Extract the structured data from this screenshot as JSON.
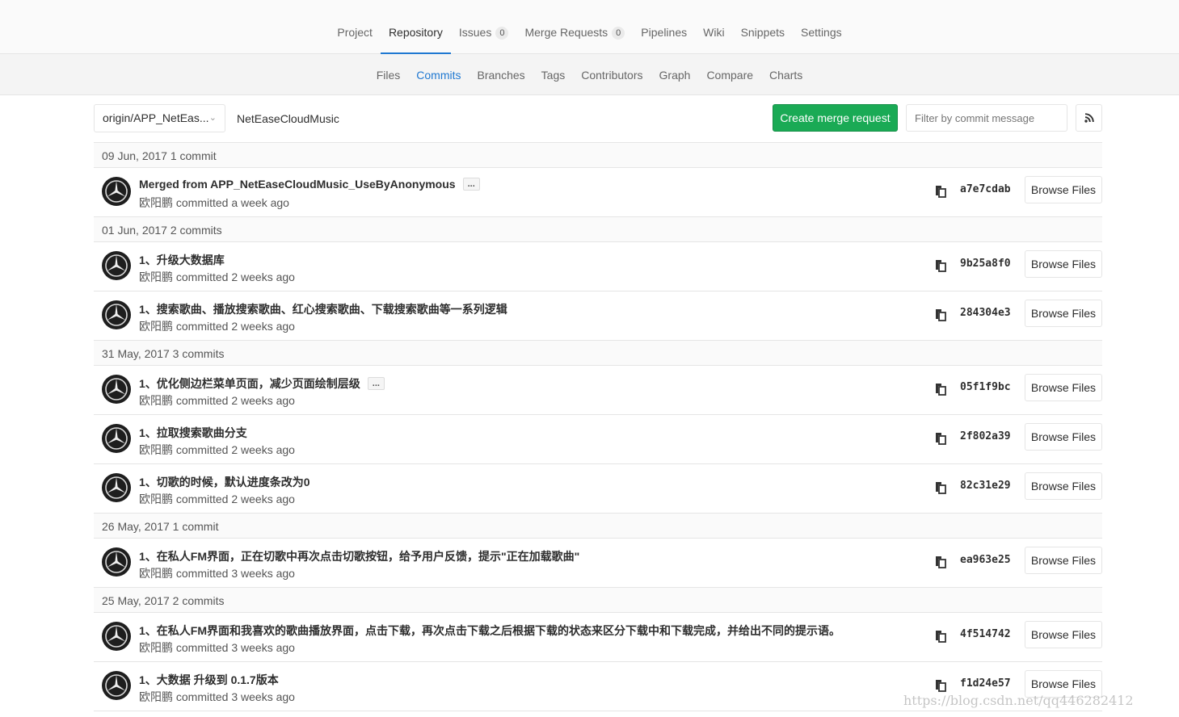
{
  "main_nav": [
    {
      "label": "Project",
      "badge": null,
      "active": false
    },
    {
      "label": "Repository",
      "badge": null,
      "active": true
    },
    {
      "label": "Issues",
      "badge": "0",
      "active": false
    },
    {
      "label": "Merge Requests",
      "badge": "0",
      "active": false
    },
    {
      "label": "Pipelines",
      "badge": null,
      "active": false
    },
    {
      "label": "Wiki",
      "badge": null,
      "active": false
    },
    {
      "label": "Snippets",
      "badge": null,
      "active": false
    },
    {
      "label": "Settings",
      "badge": null,
      "active": false
    }
  ],
  "sub_nav": [
    {
      "label": "Files",
      "active": false
    },
    {
      "label": "Commits",
      "active": true
    },
    {
      "label": "Branches",
      "active": false
    },
    {
      "label": "Tags",
      "active": false
    },
    {
      "label": "Contributors",
      "active": false
    },
    {
      "label": "Graph",
      "active": false
    },
    {
      "label": "Compare",
      "active": false
    },
    {
      "label": "Charts",
      "active": false
    }
  ],
  "toolbar": {
    "branch": "origin/APP_NetEas...",
    "path": "NetEaseCloudMusic",
    "merge_button": "Create merge request",
    "filter_placeholder": "Filter by commit message"
  },
  "commit_groups": [
    {
      "date": "09 Jun, 2017 1 commit",
      "commits": [
        {
          "title": "Merged from APP_NetEaseCloudMusic_UseByAnonymous",
          "has_more": true,
          "meta": "欧阳鹏 committed a week ago",
          "sha": "a7e7cdab"
        }
      ]
    },
    {
      "date": "01 Jun, 2017 2 commits",
      "commits": [
        {
          "title": "1、升级大数据库",
          "has_more": false,
          "meta": "欧阳鹏 committed 2 weeks ago",
          "sha": "9b25a8f0"
        },
        {
          "title": "1、搜索歌曲、播放搜索歌曲、红心搜索歌曲、下载搜索歌曲等一系列逻辑",
          "has_more": false,
          "meta": "欧阳鹏 committed 2 weeks ago",
          "sha": "284304e3"
        }
      ]
    },
    {
      "date": "31 May, 2017 3 commits",
      "commits": [
        {
          "title": "1、优化侧边栏菜单页面，减少页面绘制层级",
          "has_more": true,
          "meta": "欧阳鹏 committed 2 weeks ago",
          "sha": "05f1f9bc"
        },
        {
          "title": "1、拉取搜索歌曲分支",
          "has_more": false,
          "meta": "欧阳鹏 committed 2 weeks ago",
          "sha": "2f802a39"
        },
        {
          "title": "1、切歌的时候，默认进度条改为0",
          "has_more": false,
          "meta": "欧阳鹏 committed 2 weeks ago",
          "sha": "82c31e29"
        }
      ]
    },
    {
      "date": "26 May, 2017 1 commit",
      "commits": [
        {
          "title": "1、在私人FM界面，正在切歌中再次点击切歌按钮，给予用户反馈，提示\"正在加载歌曲\"",
          "has_more": false,
          "meta": "欧阳鹏 committed 3 weeks ago",
          "sha": "ea963e25"
        }
      ]
    },
    {
      "date": "25 May, 2017 2 commits",
      "commits": [
        {
          "title": "1、在私人FM界面和我喜欢的歌曲播放界面，点击下载，再次点击下载之后根据下载的状态来区分下载中和下载完成，并给出不同的提示语。",
          "has_more": false,
          "meta": "欧阳鹏 committed 3 weeks ago",
          "sha": "4f514742"
        },
        {
          "title": "1、大数据 升级到 0.1.7版本",
          "has_more": false,
          "meta": "欧阳鹏 committed 3 weeks ago",
          "sha": "f1d24e57"
        }
      ]
    }
  ],
  "labels": {
    "browse_files": "Browse Files",
    "more": "..."
  },
  "watermark": "https://blog.csdn.net/qq446282412",
  "colors": {
    "accent": "#1f78d1",
    "merge_button": "#1aaa55"
  },
  "icons": {
    "copy": "clipboard-icon",
    "rss": "rss-icon",
    "caret": "chevron-down-icon",
    "avatar": "mercedes-star-avatar"
  }
}
